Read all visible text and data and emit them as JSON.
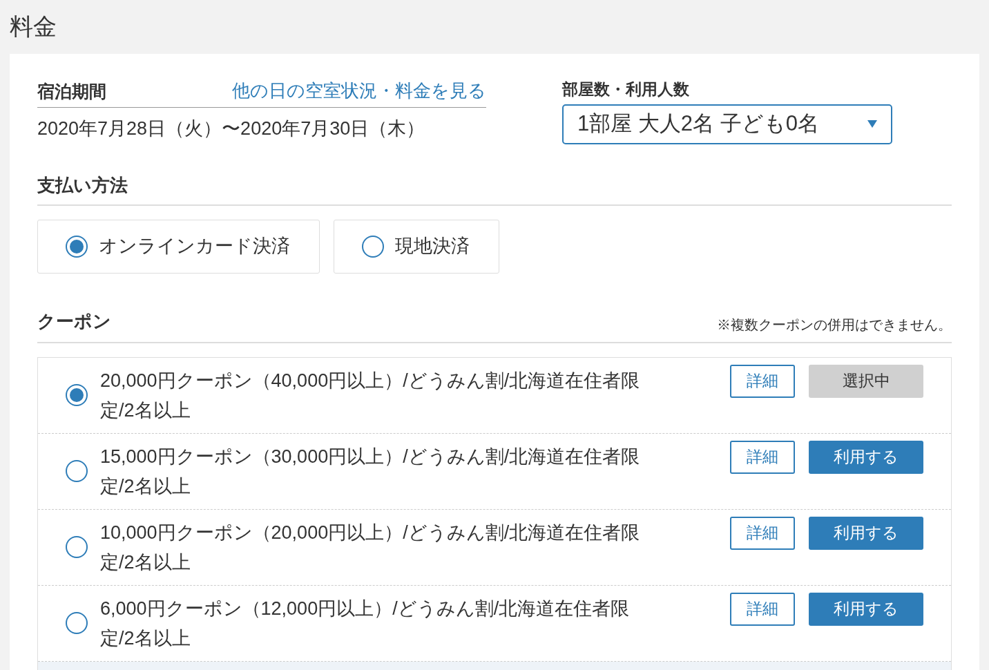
{
  "page_title": "料金",
  "stay": {
    "label": "宿泊期間",
    "link": "他の日の空室状況・料金を見る",
    "dates": "2020年7月28日（火）〜2020年7月30日（木）"
  },
  "rooms": {
    "label": "部屋数・利用人数",
    "value": "1部屋 大人2名 子ども0名"
  },
  "payment": {
    "label": "支払い方法",
    "options": [
      {
        "label": "オンラインカード決済",
        "selected": true
      },
      {
        "label": "現地決済",
        "selected": false
      }
    ]
  },
  "coupons": {
    "label": "クーポン",
    "note": "※複数クーポンの併用はできません。",
    "items": [
      {
        "text": "20,000円クーポン（40,000円以上）/どうみん割/北海道在住者限定/2名以上",
        "selected": true,
        "details": "詳細",
        "action": "選択中"
      },
      {
        "text": "15,000円クーポン（30,000円以上）/どうみん割/北海道在住者限定/2名以上",
        "selected": false,
        "details": "詳細",
        "action": "利用する"
      },
      {
        "text": "10,000円クーポン（20,000円以上）/どうみん割/北海道在住者限定/2名以上",
        "selected": false,
        "details": "詳細",
        "action": "利用する"
      },
      {
        "text": "6,000円クーポン（12,000円以上）/どうみん割/北海道在住者限定/2名以上",
        "selected": false,
        "details": "詳細",
        "action": "利用する"
      }
    ]
  }
}
